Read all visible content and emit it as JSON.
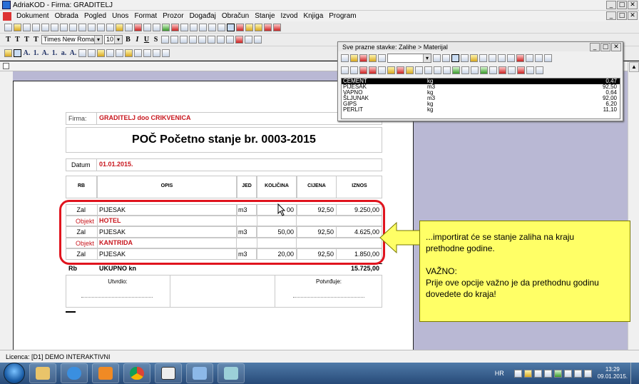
{
  "window": {
    "title": "AdriaKOD - Firma: GRADITELJ"
  },
  "menu": [
    "Dokument",
    "Obrada",
    "Pogled",
    "Unos",
    "Format",
    "Prozor",
    "Događaj",
    "Obračun",
    "Stanje",
    "Izvod",
    "Knjiga",
    "Program"
  ],
  "toolbar2": {
    "font": "Times New Roman",
    "size": "10",
    "t_labels": [
      "T",
      "T",
      "T",
      "T"
    ],
    "bold": "B",
    "italic": "I",
    "underline": "U",
    "strike": "S"
  },
  "toolbar3": {
    "letters": [
      "A.",
      "1.",
      "A.",
      "1.",
      "a.",
      "A."
    ]
  },
  "popup": {
    "title": "Sve prazne stavke: Zalihe > Materijal",
    "rows": [
      {
        "name": "CEMENT",
        "unit": "kg",
        "price": "0,47",
        "selected": true
      },
      {
        "name": "PIJESAK",
        "unit": "m3",
        "price": "92,50"
      },
      {
        "name": "VAPNO",
        "unit": "kg",
        "price": "0,64"
      },
      {
        "name": "ŠLJUNAK",
        "unit": "m3",
        "price": "92,00"
      },
      {
        "name": "GIPS",
        "unit": "kg",
        "price": "6,20"
      },
      {
        "name": "PERLIT",
        "unit": "kg",
        "price": "11,10"
      }
    ]
  },
  "doc": {
    "firma_label": "Firma:",
    "firma_value": "GRADITELJ doo CRIKVENICA",
    "heading": "POČ Početno stanje br. 0003-2015",
    "datum_label": "Datum",
    "datum_value": "01.01.2015.",
    "columns": [
      "RB",
      "OPIS",
      "JED",
      "KOLIČINA",
      "CIJENA",
      "IZNOS"
    ],
    "rows": [
      {
        "rb": "Zal",
        "opis": "PIJESAK",
        "jed": "m3",
        "kol": "00",
        "cij": "92,50",
        "izn": "9.250,00"
      },
      {
        "rb": "Objekt",
        "opis": "HOTEL",
        "obj": true
      },
      {
        "rb": "Zal",
        "opis": "PIJESAK",
        "jed": "m3",
        "kol": "50,00",
        "cij": "92,50",
        "izn": "4.625,00"
      },
      {
        "rb": "Objekt",
        "opis": "KANTRIDA",
        "obj": true
      },
      {
        "rb": "Zal",
        "opis": "PIJESAK",
        "jed": "m3",
        "kol": "20,00",
        "cij": "92,50",
        "izn": "1.850,00"
      }
    ],
    "total_rb": "Rb",
    "total_label": "UKUPNO kn",
    "total_value": "15.725,00",
    "utvrdio": "Utvrdio:",
    "potvrdjuje": "Potvrđuje:"
  },
  "callout": {
    "line1": "...importirat će se stanje zaliha na kraju",
    "line2": "prethodne godine.",
    "line3": "VAŽNO:",
    "line4": "Prije ove opcije važno je da prethodnu godinu",
    "line5": "dovedete do kraja!"
  },
  "status": {
    "licence": "Licenca: [D1] DEMO INTERAKTIVNI"
  },
  "tray": {
    "lang": "HR",
    "time": "13:29",
    "date": "09.01.2015."
  },
  "colors": {
    "doc_red": "#c8161d",
    "callout": "#ffff66",
    "highlight_border": "#e0141e",
    "workarea": "#b9b8d4"
  }
}
